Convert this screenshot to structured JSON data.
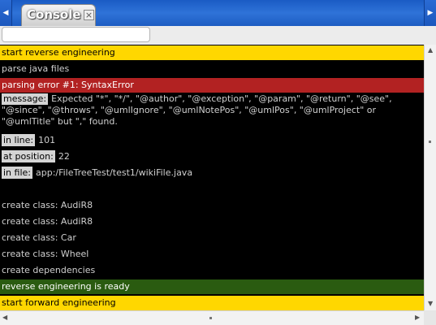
{
  "tab": {
    "title": "Console",
    "close": "×"
  },
  "filter": {
    "value": "",
    "placeholder": ""
  },
  "console": {
    "lines": [
      "start reverse engineering",
      "parse java files",
      "parsing error #1: SyntaxError"
    ],
    "message_tag": "message:",
    "message_text": "Expected \"*\", \"*/\", \"@author\", \"@exception\", \"@param\", \"@return\", \"@see\", \"@since\", \"@throws\", \"@umlIgnore\", \"@umlNotePos\", \"@umlPos\", \"@umlProject\" or \"@umlTitle\" but \",\" found.",
    "in_line_tag": "in line:",
    "in_line_value": "101",
    "position_tag": "at position:",
    "position_value": "22",
    "file_tag": "in file:",
    "file_value": "app:/FileTreeTest/test1/wikiFile.java",
    "classes": [
      "create class: AudiR8",
      "create class: AudiR8",
      "create class: Car",
      "create class: Wheel",
      "create dependencies"
    ],
    "ready": "reverse engineering is ready",
    "forward": "start forward engineering"
  },
  "colors": {
    "warning": "#ffd700",
    "error": "#b22222",
    "success": "#2a5b10"
  }
}
